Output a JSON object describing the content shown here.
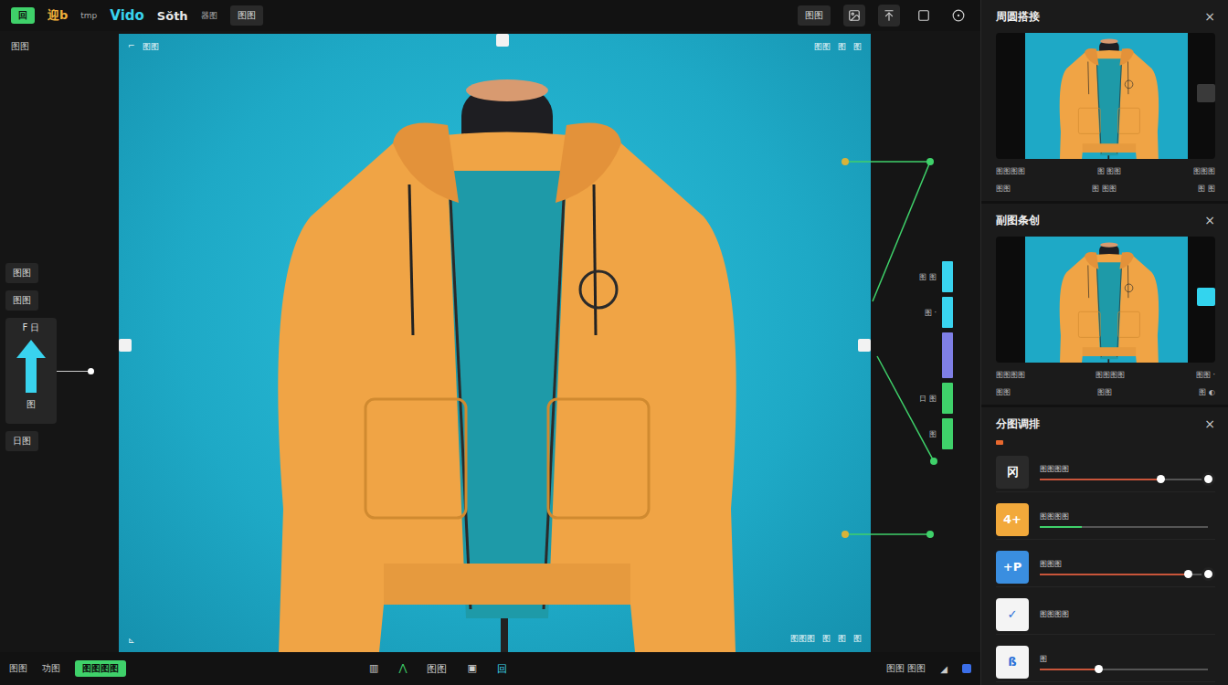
{
  "topbar": {
    "badge": "回",
    "logo": "迎b",
    "logo_sub": "tmp",
    "app_name": "Vido",
    "title": "Sŏth",
    "subtitle": "器图",
    "mode": "图图",
    "action": "图图"
  },
  "left_tools": {
    "header": "图图",
    "buttons": [
      {
        "label": "图图",
        "selected": false
      },
      {
        "label": "图图",
        "selected": false
      }
    ],
    "arrow_panel": {
      "label": "F",
      "label2": "日",
      "caption": "图"
    },
    "footer": "日图"
  },
  "canvas": {
    "top_left": [
      "⌐",
      "图图"
    ],
    "top_right": [
      "图图",
      "图",
      "图"
    ],
    "bottom_left": "⊾",
    "bottom_right": [
      "图图图",
      "图",
      "图",
      "图"
    ]
  },
  "meters": [
    {
      "label": "图 图",
      "color": "#39d3ee"
    },
    {
      "label": "图 ·",
      "color": "#39d3ee"
    },
    {
      "label": "",
      "color": "#7f7fe6"
    },
    {
      "label": "日 图",
      "color": "#3fd16a"
    },
    {
      "label": "图",
      "color": "#3fd16a"
    }
  ],
  "panels": [
    {
      "title": "周圆搭接",
      "close": "×",
      "tab_selected": false,
      "rows": [
        [
          "图图图图",
          "图 图图",
          "图图图"
        ],
        [
          "图图",
          "图 图图",
          "图 图"
        ]
      ]
    },
    {
      "title": "副图条创",
      "close": "×",
      "tab_selected": true,
      "rows": [
        [
          "图图图图",
          "图图图图",
          "图图 ·"
        ],
        [
          "图图",
          "图图",
          "图 ◐"
        ]
      ]
    }
  ],
  "adjust": {
    "title": "分图调排",
    "close": "×",
    "items": [
      {
        "kind": "slider",
        "glyph": "冈",
        "color": "#2a2a2a",
        "label": "图图图图",
        "level": 0.72
      },
      {
        "kind": "progress",
        "glyph": "4+",
        "color": "#f2a93b",
        "label": "图图图图",
        "level": 0.25
      },
      {
        "kind": "slider",
        "glyph": "+P",
        "color": "#3a8ee0",
        "label": "图图图",
        "level": 0.88
      },
      {
        "kind": "label",
        "glyph": "✓",
        "color": "#f4f4f4",
        "label": "图图图图"
      },
      {
        "kind": "slider",
        "glyph": "ß",
        "color": "#f4f4f4",
        "label": "图",
        "level": 0.35
      }
    ]
  },
  "bottombar": {
    "left": [
      "图图",
      "功图"
    ],
    "badge": "图图图图",
    "center": [
      {
        "glyph": "▥",
        "color": "#cfcfcf"
      },
      {
        "glyph": "⋀",
        "color": "#3fd16a"
      },
      {
        "glyph": "图图",
        "color": "#cfcfcf"
      },
      {
        "glyph": "▣",
        "color": "#cfcfcf"
      },
      {
        "glyph": "回",
        "color": "#3bd6ef"
      }
    ],
    "right": [
      "图图 图图",
      "◢"
    ]
  }
}
